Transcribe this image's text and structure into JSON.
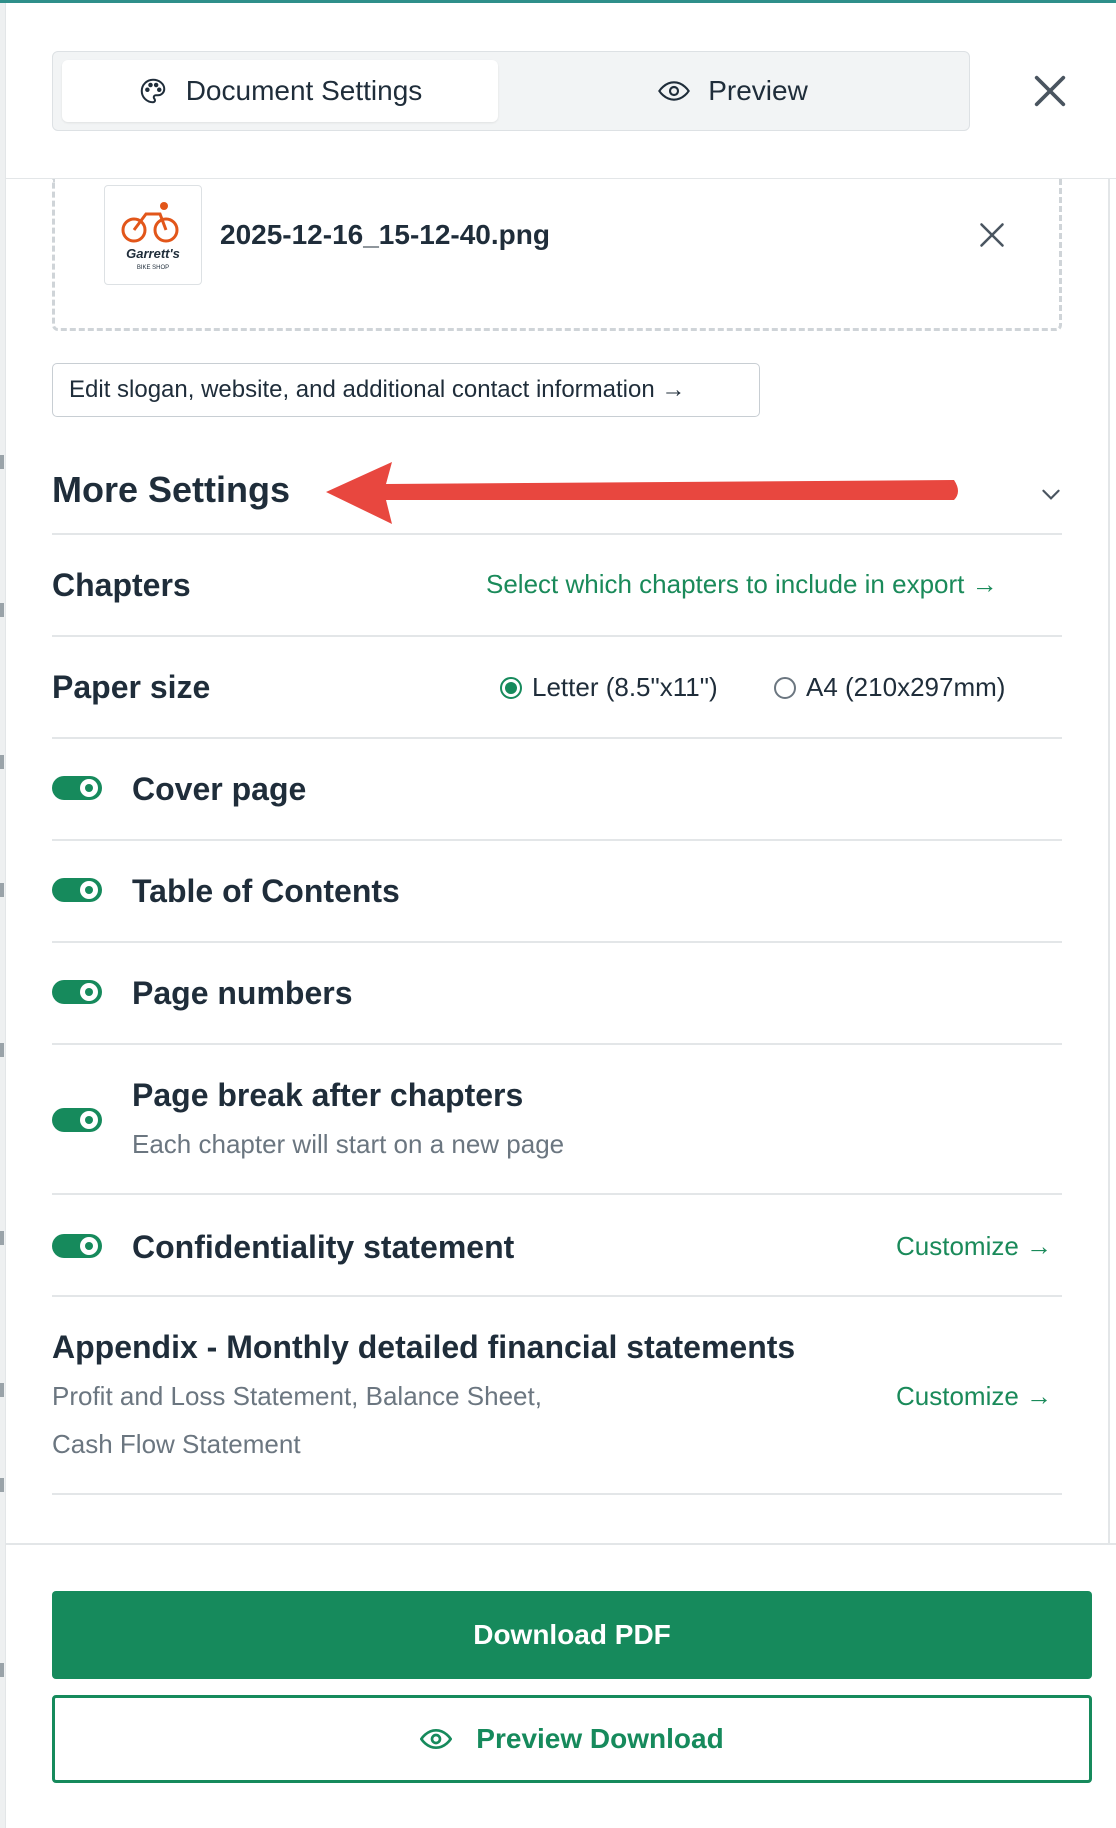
{
  "header": {
    "tabs": [
      {
        "label": "Document Settings",
        "icon": "palette-icon",
        "active": true
      },
      {
        "label": "Preview",
        "icon": "eye-icon",
        "active": false
      }
    ],
    "close_icon": "close-icon"
  },
  "logo": {
    "file_name": "2025-12-16_15-12-40.png",
    "thumb_text": "Garrett's",
    "thumb_subtext": "BIKE SHOP",
    "thumb_color": "#e2561a"
  },
  "edit_contact_label": "Edit slogan, website, and additional contact information →",
  "more_settings": {
    "title": "More Settings",
    "chevron_icon": "chevron-down-icon"
  },
  "chapters": {
    "label": "Chapters",
    "link": "Select which chapters to include in export →"
  },
  "paper_size": {
    "label": "Paper size",
    "options": [
      {
        "label": "Letter (8.5\"x11\")",
        "checked": true
      },
      {
        "label": "A4 (210x297mm)",
        "checked": false
      }
    ]
  },
  "toggles": {
    "cover_page": "Cover page",
    "table_of_contents": "Table of Contents",
    "page_numbers": "Page numbers",
    "page_break": "Page break after chapters",
    "page_break_sub": "Each chapter will start on a new page",
    "confidentiality": "Confidentiality statement",
    "confidentiality_link": "Customize →"
  },
  "appendix": {
    "title": "Appendix - Monthly detailed financial statements",
    "sub_line1": "Profit and Loss Statement, Balance Sheet,",
    "sub_line2": "Cash Flow Statement",
    "link": "Customize →"
  },
  "footer": {
    "download_pdf": "Download PDF",
    "preview_download": "Preview Download"
  },
  "colors": {
    "accent": "#168a5c",
    "link": "#1a8a5a",
    "annotation_arrow": "#e8473f"
  }
}
